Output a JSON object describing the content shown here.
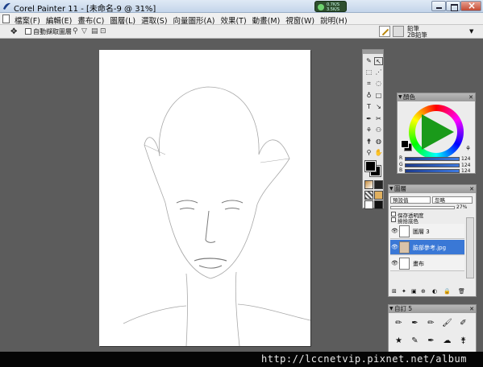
{
  "window": {
    "title": "Corel Painter 11 - [未命名-9 @ 31%]",
    "net_upload": "0.7K/S",
    "net_download": "3.5K/S"
  },
  "menu": {
    "items": [
      "檔案(F)",
      "編輯(E)",
      "畫布(C)",
      "圖層(L)",
      "選取(S)",
      "向量圖形(A)",
      "效果(T)",
      "動畫(M)",
      "視窗(W)",
      "說明(H)"
    ]
  },
  "property_bar": {
    "auto_select_label": "自動擷取圖層",
    "brush_category": "鉛筆",
    "brush_variant": "2B鉛筆"
  },
  "colors_panel": {
    "title": "顏色",
    "sliders": [
      {
        "letter": "R",
        "value": "124"
      },
      {
        "letter": "G",
        "value": "124"
      },
      {
        "letter": "B",
        "value": "124"
      }
    ]
  },
  "layers_panel": {
    "title": "圖層",
    "composite_method": "預設值",
    "composite_depth": "忽略",
    "opacity": "27%",
    "preserve_transparency": "保存透明度",
    "pick_up_underlying": "撿拾底色",
    "layers": [
      {
        "name": "圖層 3",
        "selected": false
      },
      {
        "name": "臉部參考.jpg",
        "selected": true
      },
      {
        "name": "畫布",
        "selected": false
      }
    ]
  },
  "custom_panel": {
    "title": "自訂 5"
  },
  "watermark": "http://lccnetvip.pixnet.net/album",
  "icons": {
    "app": "painter-logo-icon",
    "eye": "eye-icon",
    "brush": "brush-icon"
  }
}
